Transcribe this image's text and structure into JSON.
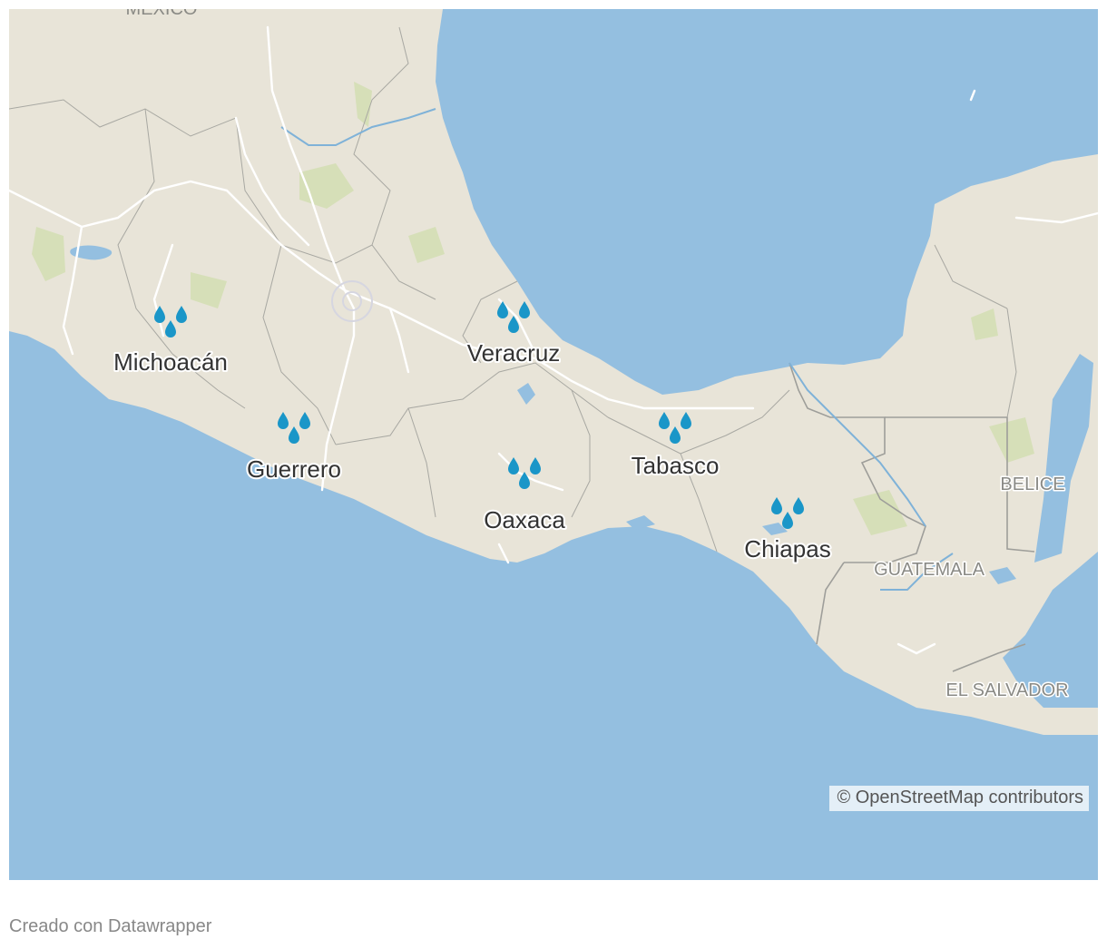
{
  "map": {
    "colors": {
      "water": "#94bfe0",
      "land": "#e8e4d8",
      "vegetation": "#d6dfb8",
      "roads": "#ffffff",
      "borders": "#9e9e9a",
      "rivers": "#7fb2d8",
      "marker": "#1a96c8"
    },
    "top_label": "MÉXICO",
    "countries": [
      {
        "key": "belice",
        "name": "BELICE"
      },
      {
        "key": "guatemala",
        "name": "GUATEMALA"
      },
      {
        "key": "el-salvador",
        "name": "EL SALVADOR"
      }
    ],
    "states": [
      {
        "key": "michoacan",
        "name": "Michoacán",
        "marker": "water-drops-icon"
      },
      {
        "key": "guerrero",
        "name": "Guerrero",
        "marker": "water-drops-icon"
      },
      {
        "key": "veracruz",
        "name": "Veracruz",
        "marker": "water-drops-icon"
      },
      {
        "key": "oaxaca",
        "name": "Oaxaca",
        "marker": "water-drops-icon"
      },
      {
        "key": "tabasco",
        "name": "Tabasco",
        "marker": "water-drops-icon"
      },
      {
        "key": "chiapas",
        "name": "Chiapas",
        "marker": "water-drops-icon"
      }
    ],
    "attribution": "© OpenStreetMap contributors"
  },
  "footer": {
    "credit": "Creado con Datawrapper"
  }
}
